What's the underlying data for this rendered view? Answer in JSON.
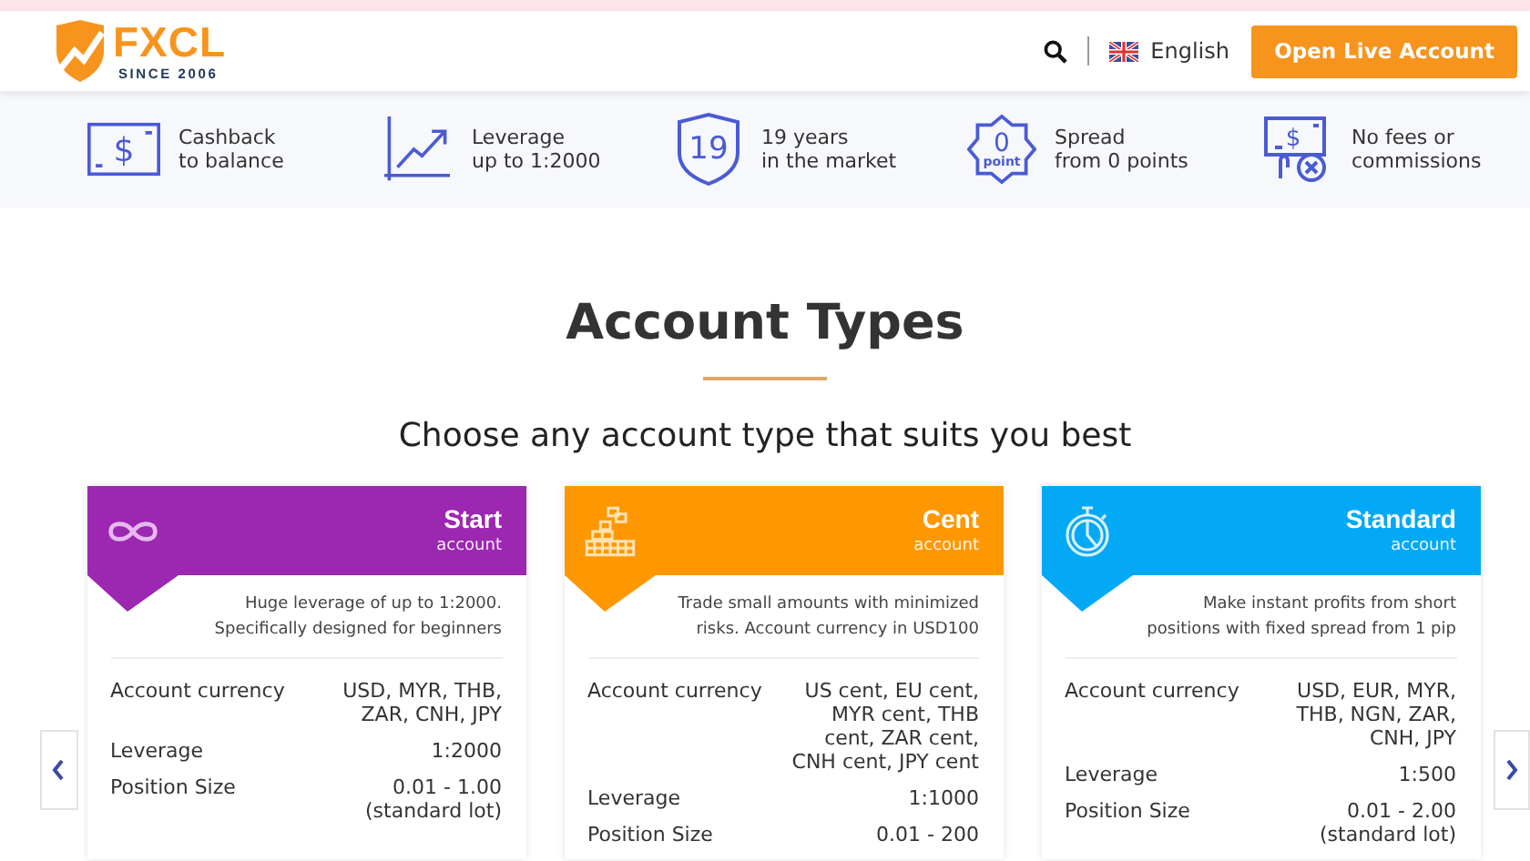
{
  "header": {
    "logo": {
      "name": "FXCL",
      "tagline": "SINCE 2006"
    },
    "language": "English",
    "cta": "Open Live Account"
  },
  "features": [
    {
      "kind": "cashback",
      "glyph": "$",
      "lines": [
        "Cashback",
        "to balance"
      ]
    },
    {
      "kind": "leverage",
      "lines": [
        "Leverage",
        "up to 1:2000"
      ]
    },
    {
      "kind": "years",
      "badge": "19",
      "lines": [
        "19 years",
        "in the market"
      ]
    },
    {
      "kind": "spread",
      "badge": "0",
      "badge_sub": "point",
      "lines": [
        "Spread",
        "from 0 points"
      ]
    },
    {
      "kind": "fees",
      "glyph": "$",
      "lines": [
        "No fees or",
        "commissions"
      ]
    }
  ],
  "title": "Account Types",
  "subtitle": "Choose any account type that suits you best",
  "cards": [
    {
      "kind": "infinity",
      "color": "#9c27b0",
      "name": "Start",
      "suffix": "account",
      "description": "Huge leverage of up to 1:2000.\nSpecifically designed for beginners",
      "rows": [
        {
          "label": "Account currency",
          "value": "USD, MYR, THB,\nZAR, CNH, JPY"
        },
        {
          "label": "Leverage",
          "value": "1:2000"
        },
        {
          "label": "Position Size",
          "value": "0.01 - 1.00\n(standard lot)"
        }
      ]
    },
    {
      "kind": "blocks",
      "color": "#ff9800",
      "name": "Cent",
      "suffix": "account",
      "description": "Trade small amounts with minimized\nrisks. Account currency in USD100",
      "rows": [
        {
          "label": "Account currency",
          "value": "US cent, EU cent,\nMYR cent, THB\ncent, ZAR cent,\nCNH cent, JPY cent"
        },
        {
          "label": "Leverage",
          "value": "1:1000"
        },
        {
          "label": "Position Size",
          "value": "0.01 - 200"
        }
      ]
    },
    {
      "kind": "stopwatch",
      "color": "#03a9f4",
      "name": "Standard",
      "suffix": "account",
      "description": "Make instant profits from short\npositions with fixed spread from 1 pip",
      "rows": [
        {
          "label": "Account currency",
          "value": "USD, EUR, MYR,\nTHB, NGN, ZAR,\nCNH, JPY"
        },
        {
          "label": "Leverage",
          "value": "1:500"
        },
        {
          "label": "Position Size",
          "value": "0.01 - 2.00\n(standard lot)"
        }
      ]
    }
  ]
}
